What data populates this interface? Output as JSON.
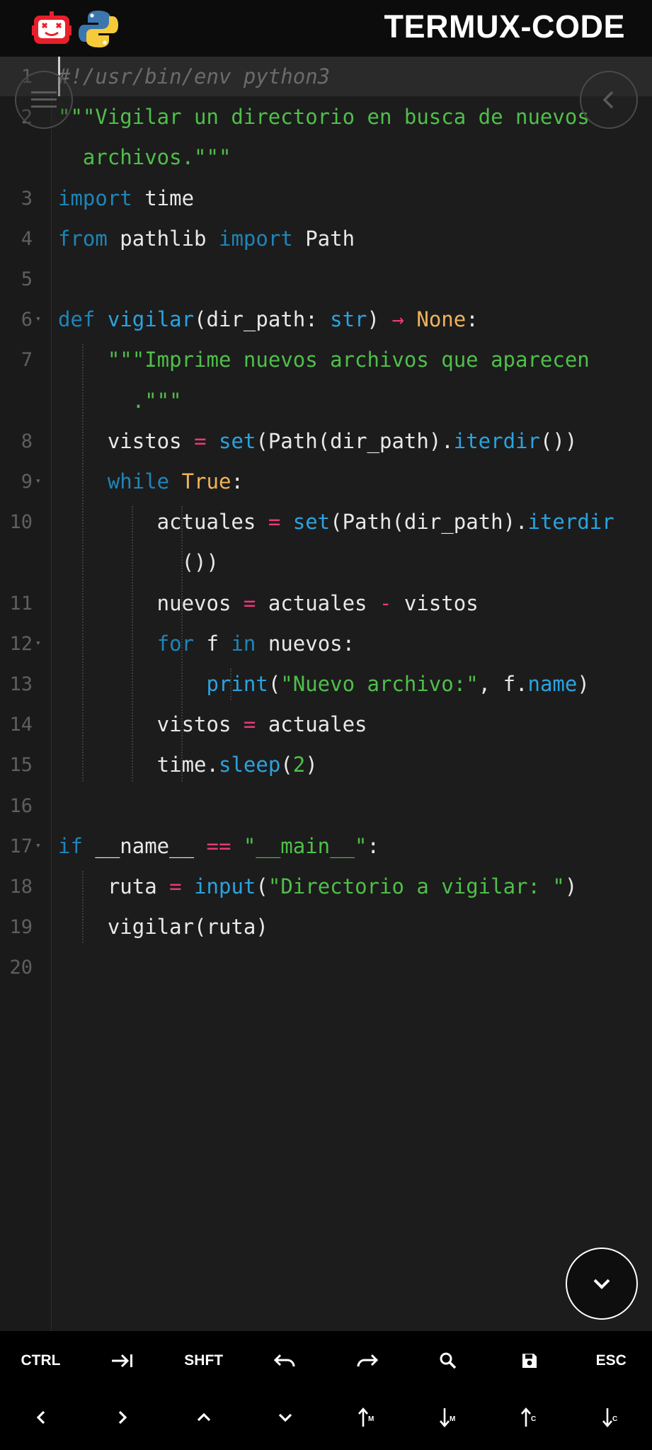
{
  "app": {
    "title": "TERMUX-CODE"
  },
  "editor": {
    "lines": [
      {
        "n": "1",
        "segs": [
          [
            "c",
            "#!/usr/bin/env python3"
          ]
        ]
      },
      {
        "n": "2",
        "segs": [
          [
            "s",
            "\"\"\"Vigilar un directorio en busca de nuevos"
          ]
        ]
      },
      {
        "n": "",
        "segs": [
          [
            "s",
            "  archivos.\"\"\""
          ]
        ]
      },
      {
        "n": "3",
        "segs": [
          [
            "k",
            "import"
          ],
          [
            "t",
            " time"
          ]
        ]
      },
      {
        "n": "4",
        "segs": [
          [
            "k",
            "from"
          ],
          [
            "t",
            " pathlib "
          ],
          [
            "k",
            "import"
          ],
          [
            "t",
            " Path"
          ]
        ]
      },
      {
        "n": "5",
        "segs": []
      },
      {
        "n": "6",
        "fold": true,
        "segs": [
          [
            "k",
            "def"
          ],
          [
            "t",
            " "
          ],
          [
            "f",
            "vigilar"
          ],
          [
            "t",
            "(dir_path: "
          ],
          [
            "f",
            "str"
          ],
          [
            "t",
            ") "
          ],
          [
            "o",
            "→"
          ],
          [
            "t",
            " "
          ],
          [
            "n",
            "None"
          ],
          [
            "t",
            ":"
          ]
        ]
      },
      {
        "n": "7",
        "segs": [
          [
            "t",
            "    "
          ],
          [
            "s",
            "\"\"\"Imprime nuevos archivos que aparecen"
          ]
        ]
      },
      {
        "n": "",
        "segs": [
          [
            "t",
            "      "
          ],
          [
            "s",
            ".\"\"\""
          ]
        ]
      },
      {
        "n": "8",
        "segs": [
          [
            "t",
            "    vistos "
          ],
          [
            "o",
            "="
          ],
          [
            "t",
            " "
          ],
          [
            "f",
            "set"
          ],
          [
            "t",
            "(Path(dir_path)."
          ],
          [
            "f",
            "iterdir"
          ],
          [
            "t",
            "())"
          ]
        ]
      },
      {
        "n": "9",
        "fold": true,
        "segs": [
          [
            "t",
            "    "
          ],
          [
            "k",
            "while"
          ],
          [
            "t",
            " "
          ],
          [
            "n",
            "True"
          ],
          [
            "t",
            ":"
          ]
        ]
      },
      {
        "n": "10",
        "segs": [
          [
            "t",
            "        actuales "
          ],
          [
            "o",
            "="
          ],
          [
            "t",
            " "
          ],
          [
            "f",
            "set"
          ],
          [
            "t",
            "(Path(dir_path)."
          ],
          [
            "f",
            "iterdir"
          ]
        ]
      },
      {
        "n": "",
        "segs": [
          [
            "t",
            "          ())"
          ]
        ]
      },
      {
        "n": "11",
        "segs": [
          [
            "t",
            "        nuevos "
          ],
          [
            "o",
            "="
          ],
          [
            "t",
            " actuales "
          ],
          [
            "o",
            "-"
          ],
          [
            "t",
            " vistos"
          ]
        ]
      },
      {
        "n": "12",
        "fold": true,
        "segs": [
          [
            "t",
            "        "
          ],
          [
            "k",
            "for"
          ],
          [
            "t",
            " f "
          ],
          [
            "k",
            "in"
          ],
          [
            "t",
            " nuevos:"
          ]
        ]
      },
      {
        "n": "13",
        "segs": [
          [
            "t",
            "            "
          ],
          [
            "f",
            "print"
          ],
          [
            "t",
            "("
          ],
          [
            "s",
            "\"Nuevo archivo:\""
          ],
          [
            "t",
            ", f."
          ],
          [
            "f",
            "name"
          ],
          [
            "t",
            ")"
          ]
        ]
      },
      {
        "n": "14",
        "segs": [
          [
            "t",
            "        vistos "
          ],
          [
            "o",
            "="
          ],
          [
            "t",
            " actuales"
          ]
        ]
      },
      {
        "n": "15",
        "segs": [
          [
            "t",
            "        time."
          ],
          [
            "f",
            "sleep"
          ],
          [
            "t",
            "("
          ],
          [
            "num",
            "2"
          ],
          [
            "t",
            ")"
          ]
        ]
      },
      {
        "n": "16",
        "segs": []
      },
      {
        "n": "17",
        "fold": true,
        "segs": [
          [
            "k",
            "if"
          ],
          [
            "t",
            " __name__ "
          ],
          [
            "o",
            "=="
          ],
          [
            "t",
            " "
          ],
          [
            "s",
            "\"__main__\""
          ],
          [
            "t",
            ":"
          ]
        ]
      },
      {
        "n": "18",
        "segs": [
          [
            "t",
            "    ruta "
          ],
          [
            "o",
            "="
          ],
          [
            "t",
            " "
          ],
          [
            "f",
            "input"
          ],
          [
            "t",
            "("
          ],
          [
            "s",
            "\"Directorio a vigilar: \""
          ],
          [
            "t",
            ")"
          ]
        ]
      },
      {
        "n": "19",
        "segs": [
          [
            "t",
            "    vigilar(ruta)"
          ]
        ]
      },
      {
        "n": "20",
        "segs": []
      }
    ]
  },
  "toolbar": {
    "row1": [
      {
        "label": "CTRL",
        "icon": ""
      },
      {
        "label": "",
        "icon": "tab-icon"
      },
      {
        "label": "SHFT",
        "icon": ""
      },
      {
        "label": "",
        "icon": "undo-icon"
      },
      {
        "label": "",
        "icon": "redo-icon"
      },
      {
        "label": "",
        "icon": "search-icon"
      },
      {
        "label": "",
        "icon": "save-icon"
      },
      {
        "label": "ESC",
        "icon": ""
      }
    ],
    "row2": [
      {
        "icon": "arrow-left-icon"
      },
      {
        "icon": "arrow-right-icon"
      },
      {
        "icon": "arrow-up-icon"
      },
      {
        "icon": "arrow-down-icon"
      },
      {
        "icon": "move-line-up-icon",
        "sub": "M"
      },
      {
        "icon": "move-line-down-icon",
        "sub": "M"
      },
      {
        "icon": "copy-line-up-icon",
        "sub": "C"
      },
      {
        "icon": "copy-line-down-icon",
        "sub": "C"
      }
    ]
  },
  "colors": {
    "background": "#1c1c1c",
    "keyword": "#1e85b8",
    "string": "#4fbf4a",
    "function": "#2aa3e0",
    "constant": "#f0b35a",
    "operator": "#e8397a"
  }
}
